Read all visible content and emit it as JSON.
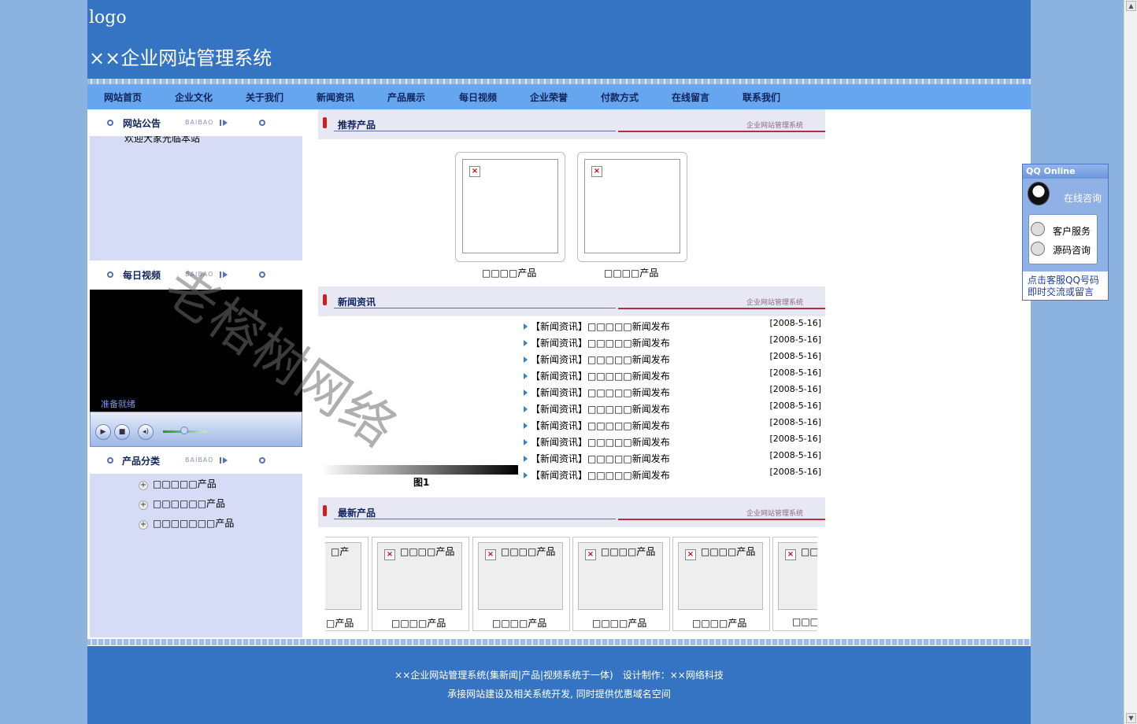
{
  "header": {
    "logo": "logo",
    "site_title": "××企业网站管理系统"
  },
  "nav": {
    "items": [
      "网站首页",
      "企业文化",
      "关于我们",
      "新闻资讯",
      "产品展示",
      "每日视频",
      "企业荣誉",
      "付款方式",
      "在线留言",
      "联系我们"
    ]
  },
  "left": {
    "notice_title": "网站公告",
    "notice_en": "BAIBAO",
    "notice_text": "欢迎大家光临本站",
    "video_title": "每日视频",
    "video_en": "BAIBAO",
    "video_status": "准备就绪",
    "category_title": "产品分类",
    "category_en": "BAIBAO",
    "categories": [
      "□□□□□产品",
      "□□□□□□产品",
      "□□□□□□□产品"
    ]
  },
  "main": {
    "recommend": {
      "title": "推荐产品",
      "sub": "企业网站管理系统",
      "items": [
        "□□□□产品",
        "□□□□产品"
      ]
    },
    "news": {
      "title": "新闻资讯",
      "sub": "企业网站管理系统",
      "figure_label": "图1",
      "items": [
        {
          "text": "【新闻资讯】□□□□□新闻发布",
          "date": "[2008-5-16]"
        },
        {
          "text": "【新闻资讯】□□□□□新闻发布",
          "date": "[2008-5-16]"
        },
        {
          "text": "【新闻资讯】□□□□□新闻发布",
          "date": "[2008-5-16]"
        },
        {
          "text": "【新闻资讯】□□□□□新闻发布",
          "date": "[2008-5-16]"
        },
        {
          "text": "【新闻资讯】□□□□□新闻发布",
          "date": "[2008-5-16]"
        },
        {
          "text": "【新闻资讯】□□□□□新闻发布",
          "date": "[2008-5-16]"
        },
        {
          "text": "【新闻资讯】□□□□□新闻发布",
          "date": "[2008-5-16]"
        },
        {
          "text": "【新闻资讯】□□□□□新闻发布",
          "date": "[2008-5-16]"
        },
        {
          "text": "【新闻资讯】□□□□□新闻发布",
          "date": "[2008-5-16]"
        },
        {
          "text": "【新闻资讯】□□□□□新闻发布",
          "date": "[2008-5-16]"
        }
      ]
    },
    "latest": {
      "title": "最新产品",
      "sub": "企业网站管理系统",
      "items": [
        {
          "inner": "□产",
          "caption": "□产品"
        },
        {
          "inner": "□□□□产品",
          "caption": "□□□□产品"
        },
        {
          "inner": "□□□□产品",
          "caption": "□□□□产品"
        },
        {
          "inner": "□□□□产品",
          "caption": "□□□□产品"
        },
        {
          "inner": "□□□□产品",
          "caption": "□□□□产品"
        },
        {
          "inner": "□□",
          "caption": "□□□"
        }
      ]
    }
  },
  "footer": {
    "line1": "××企业网站管理系统(集新闻|产品|视频系统于一体)　设计制作：××网络科技",
    "line2": "承接网站建设及相关系统开发, 同时提供优惠域名空间"
  },
  "qq": {
    "header": "QQ Online",
    "online": "在线咨询",
    "service1": "客户服务",
    "service2": "源码咨询",
    "foot1": "点击客服QQ号码",
    "foot2": "即时交流或留言"
  },
  "watermark": "老榕树网络"
}
